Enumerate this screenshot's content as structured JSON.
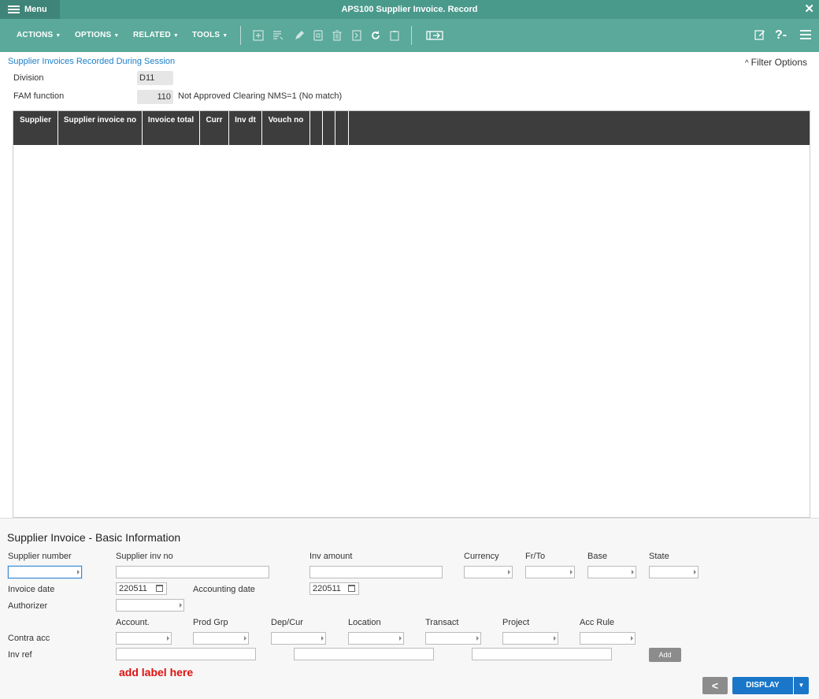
{
  "titlebar": {
    "menu_label": "Menu",
    "title": "APS100 Supplier Invoice. Record",
    "close": "✕"
  },
  "toolbar": {
    "menus": [
      {
        "label": "ACTIONS",
        "caret": "▼"
      },
      {
        "label": "OPTIONS",
        "caret": "▼"
      },
      {
        "label": "RELATED",
        "caret": "▼"
      },
      {
        "label": "TOOLS",
        "caret": "▼"
      }
    ],
    "icons": [
      "add-icon",
      "list-icon",
      "edit-icon",
      "copy-icon",
      "delete-icon",
      "display-icon",
      "refresh-icon",
      "clipboard-icon",
      "panel-toggle-icon"
    ],
    "right_icons": [
      "notes-icon",
      "help-icon",
      "more-menu-icon"
    ],
    "help_label": "?-"
  },
  "header": {
    "section_link": "Supplier Invoices Recorded During Session",
    "filter_options": "Filter Options",
    "filter_icon": "^",
    "division_label": "Division",
    "division_value": "D11",
    "fam_label": "FAM function",
    "fam_value": "110",
    "fam_description": "Not Approved Clearing NMS=1   (No match)"
  },
  "grid": {
    "columns": [
      "Supplier",
      "Supplier invoice no",
      "Invoice total",
      "Curr",
      "Inv dt",
      "Vouch no",
      "",
      "",
      ""
    ],
    "rows": []
  },
  "form": {
    "title": "Supplier Invoice - Basic Information",
    "labels": {
      "supplier_number": "Supplier number",
      "supplier_inv_no": "Supplier inv no",
      "inv_amount": "Inv amount",
      "currency": "Currency",
      "fr_to": "Fr/To",
      "base": "Base",
      "state": "State",
      "invoice_date": "Invoice date",
      "accounting_date": "Accounting date",
      "authorizer": "Authorizer",
      "account": "Account.",
      "prod_grp": "Prod Grp",
      "dep_cur": "Dep/Cur",
      "location": "Location",
      "transact": "Transact",
      "project": "Project",
      "acc_rule": "Acc Rule",
      "contra_acc": "Contra acc",
      "inv_ref": "Inv ref"
    },
    "values": {
      "invoice_date": "220511",
      "accounting_date": "220511"
    },
    "add_button": "Add",
    "add_label_note": "add label here"
  },
  "footer": {
    "back_label": "<",
    "display_label": "DISPLAY",
    "display_caret": "▼"
  },
  "colors": {
    "titlebar": "#4a9a8c",
    "toolbar": "#5aa99a",
    "grid_header": "#3d3d3d",
    "link": "#1a7fc9",
    "primary_button": "#1a76c8",
    "warning_text": "#e01010"
  }
}
